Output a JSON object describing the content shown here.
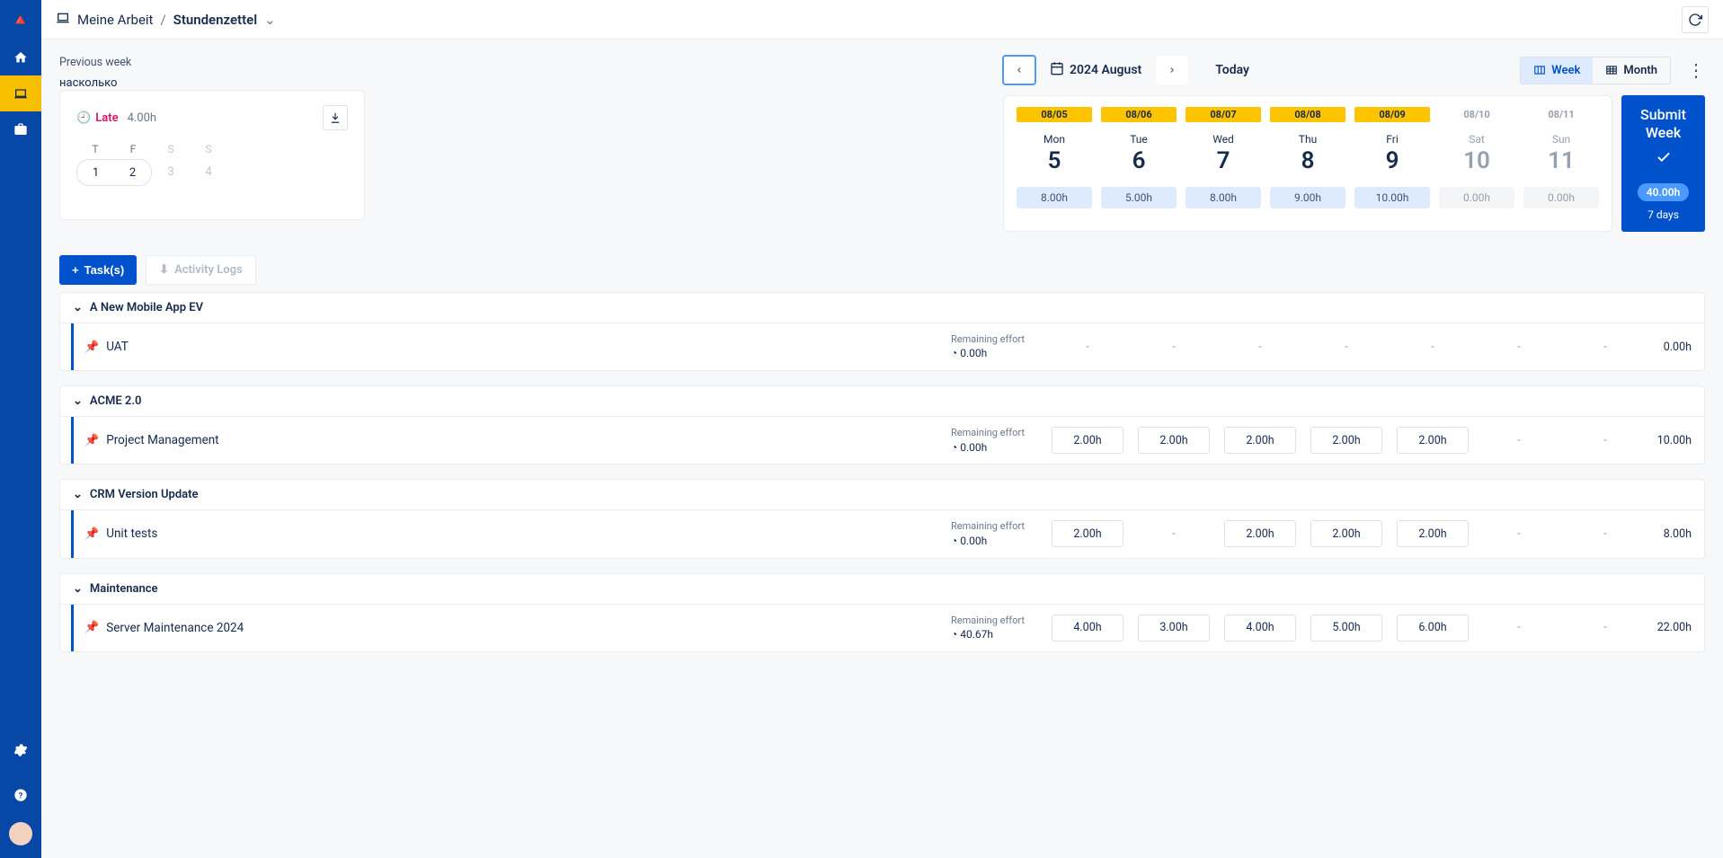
{
  "header": {
    "crumb_icon": "laptop-icon",
    "crumb1": "Meine Arbeit",
    "crumb2": "Stundenzettel"
  },
  "nav": {
    "previous_week": "Previous week",
    "month_label": "2024 August",
    "today": "Today",
    "week": "Week",
    "month": "Month"
  },
  "late": {
    "label": "Late",
    "hours": "4.00h",
    "heads": [
      {
        "t": "T",
        "d": true
      },
      {
        "t": "F",
        "d": true
      },
      {
        "t": "S",
        "d": false
      },
      {
        "t": "S",
        "d": false
      }
    ],
    "days": [
      {
        "n": "1",
        "d": true,
        "f": true
      },
      {
        "n": "2",
        "d": true,
        "l": true
      },
      {
        "n": "3",
        "d": false
      },
      {
        "n": "4",
        "d": false
      }
    ]
  },
  "days": [
    {
      "date": "08/05",
      "name": "Mon",
      "num": "5",
      "hours": "8.00h",
      "muted": false
    },
    {
      "date": "08/06",
      "name": "Tue",
      "num": "6",
      "hours": "5.00h",
      "muted": false
    },
    {
      "date": "08/07",
      "name": "Wed",
      "num": "7",
      "hours": "8.00h",
      "muted": false
    },
    {
      "date": "08/08",
      "name": "Thu",
      "num": "8",
      "hours": "9.00h",
      "muted": false
    },
    {
      "date": "08/09",
      "name": "Fri",
      "num": "9",
      "hours": "10.00h",
      "muted": false
    },
    {
      "date": "08/10",
      "name": "Sat",
      "num": "10",
      "hours": "0.00h",
      "muted": true
    },
    {
      "date": "08/11",
      "name": "Sun",
      "num": "11",
      "hours": "0.00h",
      "muted": true
    }
  ],
  "submit": {
    "title": "Submit Week",
    "hours": "40.00h",
    "days": "7 days"
  },
  "buttons": {
    "tasks": "Task(s)",
    "activity": "Activity Logs"
  },
  "labels": {
    "remaining_effort": "Remaining effort"
  },
  "groups": [
    {
      "name": "A New Mobile App EV",
      "tasks": [
        {
          "name": "UAT",
          "effort": "0.00h",
          "cells": [
            "-",
            "-",
            "-",
            "-",
            "-",
            "-",
            "-"
          ],
          "total": "0.00h",
          "empty": [
            0,
            1,
            2,
            3,
            4,
            5,
            6
          ]
        }
      ]
    },
    {
      "name": "ACME 2.0",
      "tasks": [
        {
          "name": "Project Management",
          "effort": "0.00h",
          "cells": [
            "2.00h",
            "2.00h",
            "2.00h",
            "2.00h",
            "2.00h",
            "-",
            "-"
          ],
          "total": "10.00h",
          "empty": [
            5,
            6
          ]
        }
      ]
    },
    {
      "name": "CRM Version Update",
      "tasks": [
        {
          "name": "Unit tests",
          "effort": "0.00h",
          "cells": [
            "2.00h",
            "-",
            "2.00h",
            "2.00h",
            "2.00h",
            "-",
            "-"
          ],
          "total": "8.00h",
          "empty": [
            1,
            5,
            6
          ]
        }
      ]
    },
    {
      "name": "Maintenance",
      "tasks": [
        {
          "name": "Server Maintenance 2024",
          "effort": "40.67h",
          "cells": [
            "4.00h",
            "3.00h",
            "4.00h",
            "5.00h",
            "6.00h",
            "-",
            "-"
          ],
          "total": "22.00h",
          "empty": [
            5,
            6
          ]
        }
      ]
    }
  ]
}
